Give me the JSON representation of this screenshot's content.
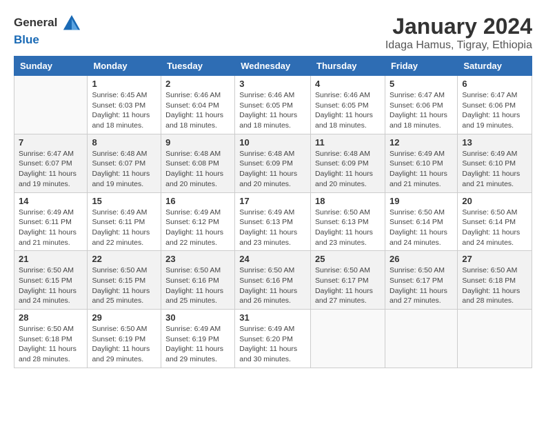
{
  "logo": {
    "general": "General",
    "blue": "Blue"
  },
  "title": "January 2024",
  "subtitle": "Idaga Hamus, Tigray, Ethiopia",
  "header": {
    "days": [
      "Sunday",
      "Monday",
      "Tuesday",
      "Wednesday",
      "Thursday",
      "Friday",
      "Saturday"
    ]
  },
  "weeks": [
    [
      {
        "day": "",
        "info": ""
      },
      {
        "day": "1",
        "info": "Sunrise: 6:45 AM\nSunset: 6:03 PM\nDaylight: 11 hours\nand 18 minutes."
      },
      {
        "day": "2",
        "info": "Sunrise: 6:46 AM\nSunset: 6:04 PM\nDaylight: 11 hours\nand 18 minutes."
      },
      {
        "day": "3",
        "info": "Sunrise: 6:46 AM\nSunset: 6:05 PM\nDaylight: 11 hours\nand 18 minutes."
      },
      {
        "day": "4",
        "info": "Sunrise: 6:46 AM\nSunset: 6:05 PM\nDaylight: 11 hours\nand 18 minutes."
      },
      {
        "day": "5",
        "info": "Sunrise: 6:47 AM\nSunset: 6:06 PM\nDaylight: 11 hours\nand 18 minutes."
      },
      {
        "day": "6",
        "info": "Sunrise: 6:47 AM\nSunset: 6:06 PM\nDaylight: 11 hours\nand 19 minutes."
      }
    ],
    [
      {
        "day": "7",
        "info": "Sunrise: 6:47 AM\nSunset: 6:07 PM\nDaylight: 11 hours\nand 19 minutes."
      },
      {
        "day": "8",
        "info": "Sunrise: 6:48 AM\nSunset: 6:07 PM\nDaylight: 11 hours\nand 19 minutes."
      },
      {
        "day": "9",
        "info": "Sunrise: 6:48 AM\nSunset: 6:08 PM\nDaylight: 11 hours\nand 20 minutes."
      },
      {
        "day": "10",
        "info": "Sunrise: 6:48 AM\nSunset: 6:09 PM\nDaylight: 11 hours\nand 20 minutes."
      },
      {
        "day": "11",
        "info": "Sunrise: 6:48 AM\nSunset: 6:09 PM\nDaylight: 11 hours\nand 20 minutes."
      },
      {
        "day": "12",
        "info": "Sunrise: 6:49 AM\nSunset: 6:10 PM\nDaylight: 11 hours\nand 21 minutes."
      },
      {
        "day": "13",
        "info": "Sunrise: 6:49 AM\nSunset: 6:10 PM\nDaylight: 11 hours\nand 21 minutes."
      }
    ],
    [
      {
        "day": "14",
        "info": "Sunrise: 6:49 AM\nSunset: 6:11 PM\nDaylight: 11 hours\nand 21 minutes."
      },
      {
        "day": "15",
        "info": "Sunrise: 6:49 AM\nSunset: 6:11 PM\nDaylight: 11 hours\nand 22 minutes."
      },
      {
        "day": "16",
        "info": "Sunrise: 6:49 AM\nSunset: 6:12 PM\nDaylight: 11 hours\nand 22 minutes."
      },
      {
        "day": "17",
        "info": "Sunrise: 6:49 AM\nSunset: 6:13 PM\nDaylight: 11 hours\nand 23 minutes."
      },
      {
        "day": "18",
        "info": "Sunrise: 6:50 AM\nSunset: 6:13 PM\nDaylight: 11 hours\nand 23 minutes."
      },
      {
        "day": "19",
        "info": "Sunrise: 6:50 AM\nSunset: 6:14 PM\nDaylight: 11 hours\nand 24 minutes."
      },
      {
        "day": "20",
        "info": "Sunrise: 6:50 AM\nSunset: 6:14 PM\nDaylight: 11 hours\nand 24 minutes."
      }
    ],
    [
      {
        "day": "21",
        "info": "Sunrise: 6:50 AM\nSunset: 6:15 PM\nDaylight: 11 hours\nand 24 minutes."
      },
      {
        "day": "22",
        "info": "Sunrise: 6:50 AM\nSunset: 6:15 PM\nDaylight: 11 hours\nand 25 minutes."
      },
      {
        "day": "23",
        "info": "Sunrise: 6:50 AM\nSunset: 6:16 PM\nDaylight: 11 hours\nand 25 minutes."
      },
      {
        "day": "24",
        "info": "Sunrise: 6:50 AM\nSunset: 6:16 PM\nDaylight: 11 hours\nand 26 minutes."
      },
      {
        "day": "25",
        "info": "Sunrise: 6:50 AM\nSunset: 6:17 PM\nDaylight: 11 hours\nand 27 minutes."
      },
      {
        "day": "26",
        "info": "Sunrise: 6:50 AM\nSunset: 6:17 PM\nDaylight: 11 hours\nand 27 minutes."
      },
      {
        "day": "27",
        "info": "Sunrise: 6:50 AM\nSunset: 6:18 PM\nDaylight: 11 hours\nand 28 minutes."
      }
    ],
    [
      {
        "day": "28",
        "info": "Sunrise: 6:50 AM\nSunset: 6:18 PM\nDaylight: 11 hours\nand 28 minutes."
      },
      {
        "day": "29",
        "info": "Sunrise: 6:50 AM\nSunset: 6:19 PM\nDaylight: 11 hours\nand 29 minutes."
      },
      {
        "day": "30",
        "info": "Sunrise: 6:49 AM\nSunset: 6:19 PM\nDaylight: 11 hours\nand 29 minutes."
      },
      {
        "day": "31",
        "info": "Sunrise: 6:49 AM\nSunset: 6:20 PM\nDaylight: 11 hours\nand 30 minutes."
      },
      {
        "day": "",
        "info": ""
      },
      {
        "day": "",
        "info": ""
      },
      {
        "day": "",
        "info": ""
      }
    ]
  ]
}
